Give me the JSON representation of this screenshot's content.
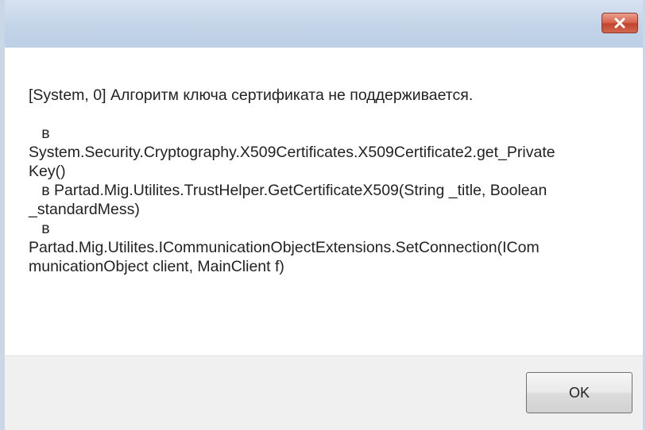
{
  "window": {
    "close_icon": "close-icon"
  },
  "message": {
    "title_line": "[System, 0] Алгоритм ключа сертификата не поддерживается.",
    "stack_lines": [
      "   в",
      "System.Security.Cryptography.X509Certificates.X509Certificate2.get_Private",
      "Key()",
      "   в Partad.Mig.Utilites.TrustHelper.GetCertificateX509(String _title, Boolean",
      "_standardMess)",
      "   в",
      "Partad.Mig.Utilites.ICommunicationObjectExtensions.SetConnection(ICom",
      "municationObject client, MainClient f)"
    ]
  },
  "buttons": {
    "ok_label": "OK"
  }
}
